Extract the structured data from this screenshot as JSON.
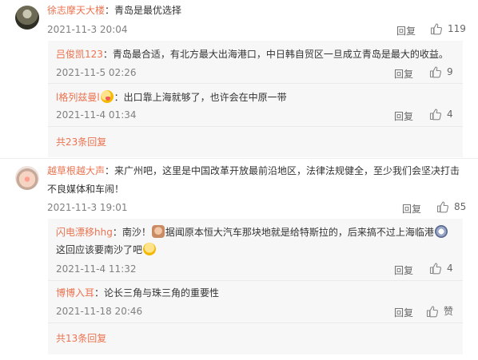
{
  "comments": [
    {
      "author": "徐志摩天大楼",
      "text": "：青岛是最优选择",
      "time": "2021-11-3 20:04",
      "reply_label": "回复",
      "likes": "119",
      "replies": [
        {
          "author": "吕俊凯123",
          "text": "：青岛最合适，有北方最大出海港口，中日韩自贸区一旦成立青岛是最大的收益。",
          "time": "2021-11-5 02:26",
          "reply_label": "回复",
          "likes": "9"
        },
        {
          "author": "l格列兹曼l",
          "emoji": "heart-eyes-emoji",
          "text": "：出口靠上海就够了，也许会在中原一带",
          "time": "2021-11-4 01:34",
          "reply_label": "回复",
          "likes": "4"
        }
      ],
      "more_replies": "共23条回复"
    },
    {
      "author": "越草根越大声",
      "text_line1": "：来广州吧，这里是中国改革开放最前沿地区，法律法规健全，至少我们会坚决打击",
      "text_line2": "不良媒体和车闹！",
      "time": "2021-11-3 19:01",
      "reply_label": "回复",
      "likes": "85",
      "replies": [
        {
          "author": "闪电漂移hhg",
          "text_a": "：南沙！",
          "text_b": "据闻原本恒大汽车那块地就是给特斯拉的，后来搞不过上海临港",
          "text_line2": "这回应该要南沙了吧",
          "time": "2021-11-4 11:32",
          "reply_label": "回复",
          "likes": "4"
        },
        {
          "author": "博博入耳",
          "text": "：论长三角与珠三角的重要性",
          "time": "2021-11-18 20:46",
          "reply_label": "回复",
          "likes": "赞"
        }
      ],
      "more_replies": "共13条回复"
    }
  ]
}
